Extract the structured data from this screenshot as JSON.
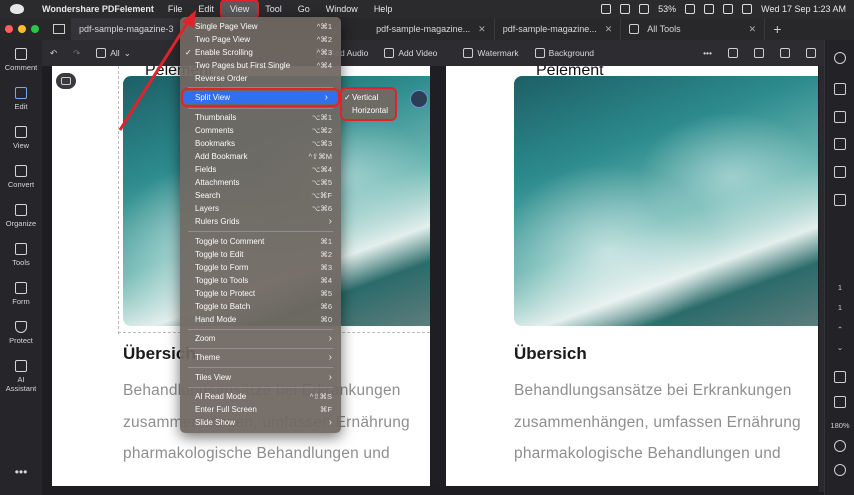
{
  "menubar": {
    "app_name": "Wondershare PDFelement",
    "items": [
      "File",
      "Edit",
      "View",
      "Tool",
      "Go",
      "Window",
      "Help"
    ],
    "battery": "53%",
    "datetime": "Wed 17 Sep  1:23 AM"
  },
  "tabs": [
    {
      "label": "pdf-sample-magazine-3"
    },
    {
      "label": "pdf-sample-magazine..."
    },
    {
      "label": "pdf-sample-magazine..."
    },
    {
      "label": "All Tools"
    }
  ],
  "toolbar": {
    "all_label": "All",
    "add_audio": "Add Audio",
    "add_video": "Add Video",
    "watermark": "Watermark",
    "background": "Background"
  },
  "left_sidebar": [
    "Comment",
    "Edit",
    "View",
    "Convert",
    "Organize",
    "Tools",
    "Form",
    "Protect",
    "AI Assistant"
  ],
  "right_sidebar": {
    "page_current": "1",
    "page_total": "1",
    "zoom": "180%"
  },
  "document": {
    "heading": "Übersich",
    "partial_top": "Pelement",
    "lines_left": [
      "Behandlungsansätze bei Erkrankungen",
      "zusammenhängen, umfassen Ernährung",
      "pharmakologische Behandlungen und"
    ],
    "lines_right": [
      "Behandlungsansätze bei Erkrankungen",
      "zusammenhängen, umfassen Ernährung",
      "pharmakologische Behandlungen und"
    ]
  },
  "view_menu": {
    "items": [
      {
        "label": "Single Page View",
        "shortcut": "^⌘1"
      },
      {
        "label": "Two Page View",
        "shortcut": "^⌘2"
      },
      {
        "label": "Enable Scrolling",
        "shortcut": "^⌘3",
        "checked": "✓"
      },
      {
        "label": "Two Pages but First Single",
        "shortcut": "^⌘4"
      },
      {
        "label": "Reverse Order",
        "shortcut": ""
      },
      {
        "label": "Split View",
        "shortcut": "›"
      },
      {
        "label": "Thumbnails",
        "shortcut": "⌥⌘1"
      },
      {
        "label": "Comments",
        "shortcut": "⌥⌘2"
      },
      {
        "label": "Bookmarks",
        "shortcut": "⌥⌘3"
      },
      {
        "label": "Add Bookmark",
        "shortcut": "^⇧⌘M"
      },
      {
        "label": "Fields",
        "shortcut": "⌥⌘4"
      },
      {
        "label": "Attachments",
        "shortcut": "⌥⌘5"
      },
      {
        "label": "Search",
        "shortcut": "⌥⌘F"
      },
      {
        "label": "Layers",
        "shortcut": "⌥⌘6"
      },
      {
        "label": "Rulers Grids",
        "shortcut": "›"
      },
      {
        "label": "Toggle to Comment",
        "shortcut": "⌘1"
      },
      {
        "label": "Toggle to Edit",
        "shortcut": "⌘2"
      },
      {
        "label": "Toggle to Form",
        "shortcut": "⌘3"
      },
      {
        "label": "Toggle to Tools",
        "shortcut": "⌘4"
      },
      {
        "label": "Toggle to Protect",
        "shortcut": "⌘5"
      },
      {
        "label": "Toggle to Batch",
        "shortcut": "⌘6"
      },
      {
        "label": "Hand Mode",
        "shortcut": "⌘0"
      },
      {
        "label": "Zoom",
        "shortcut": "›"
      },
      {
        "label": "Theme",
        "shortcut": "›"
      },
      {
        "label": "Tiles View",
        "shortcut": "›"
      },
      {
        "label": "AI Read Mode",
        "shortcut": "^⇧⌘S"
      },
      {
        "label": "Enter Full Screen",
        "shortcut": "⌘F"
      },
      {
        "label": "Slide Show",
        "shortcut": "›"
      }
    ]
  },
  "split_submenu": {
    "items": [
      {
        "label": "Vertical",
        "checked": "✓"
      },
      {
        "label": "Horizontal"
      }
    ]
  }
}
